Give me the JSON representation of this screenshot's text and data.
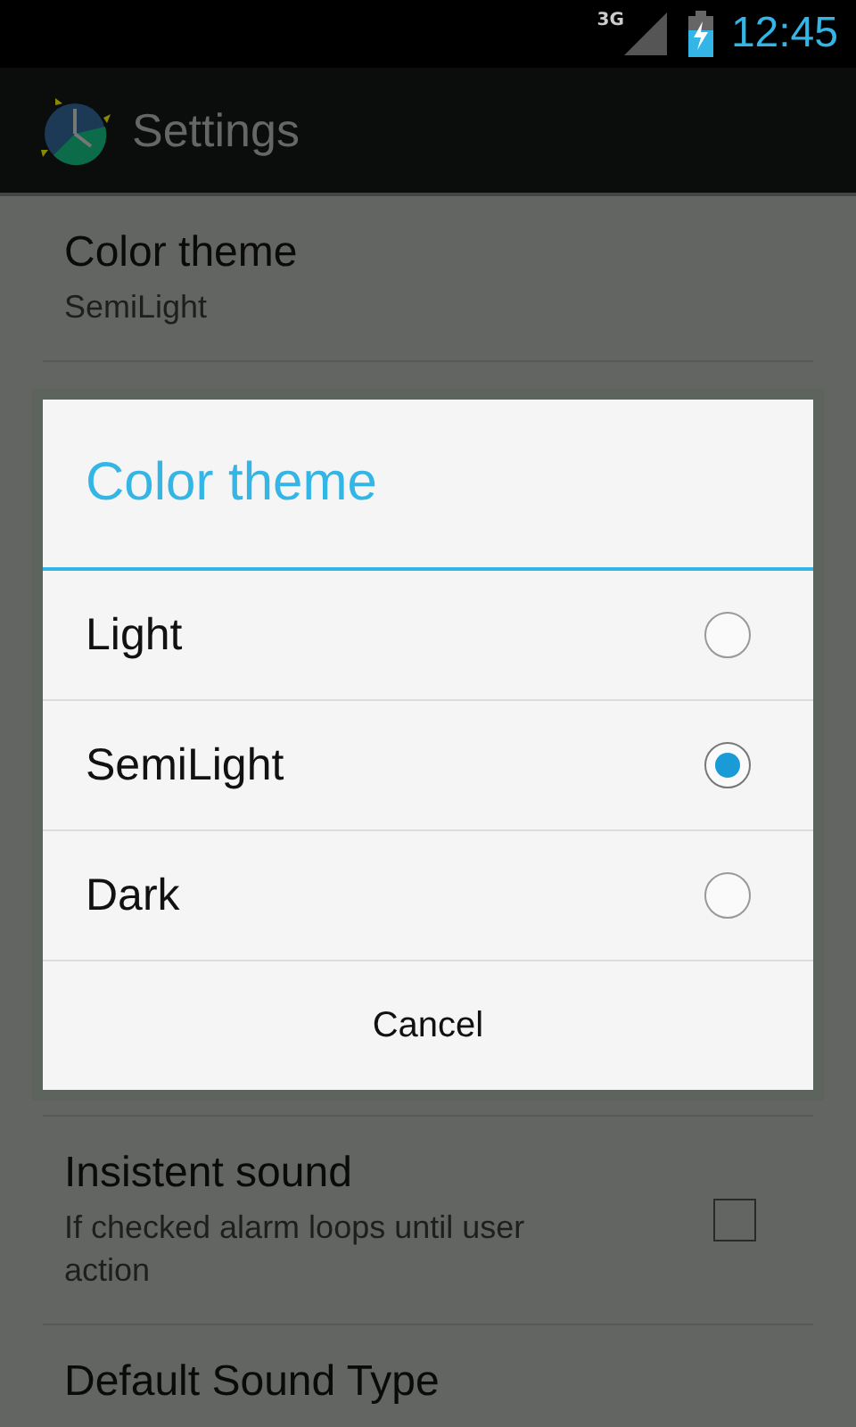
{
  "status_bar": {
    "network": "3G",
    "time": "12:45"
  },
  "action_bar": {
    "title": "Settings"
  },
  "settings": [
    {
      "kind": "value",
      "title": "Color theme",
      "summary": "SemiLight"
    },
    {
      "kind": "checkbox",
      "title": "Insistent sound",
      "summary": "If checked alarm loops until user action",
      "checked": false
    },
    {
      "kind": "title",
      "title": "Default Sound Type"
    }
  ],
  "dialog": {
    "title": "Color theme",
    "options": [
      {
        "label": "Light",
        "selected": false
      },
      {
        "label": "SemiLight",
        "selected": true
      },
      {
        "label": "Dark",
        "selected": false
      }
    ],
    "button": "Cancel"
  }
}
